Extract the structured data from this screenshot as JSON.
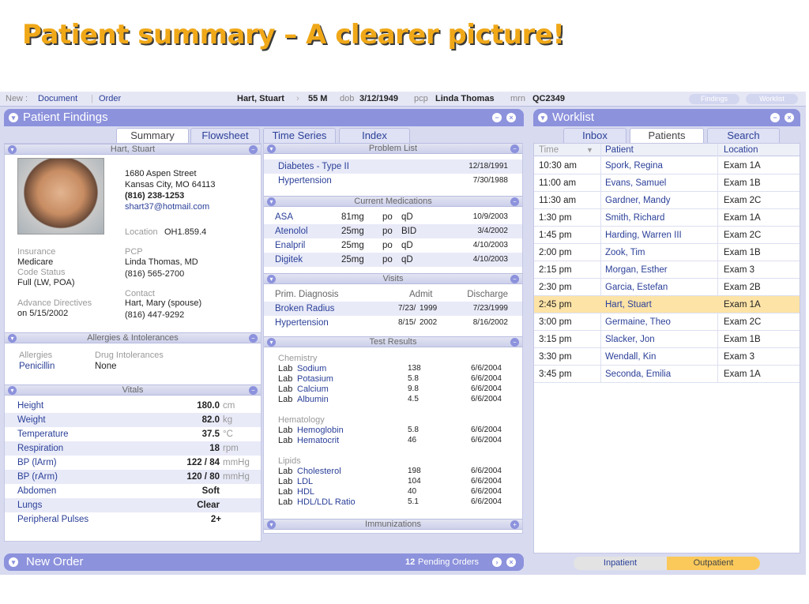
{
  "slide_title": "Patient summary – A clearer picture!",
  "topbar": {
    "new_label": "New :",
    "document": "Document",
    "order": "Order",
    "patient_name": "Hart, Stuart",
    "age_sex": "55 M",
    "dob_label": "dob",
    "dob": "3/12/1949",
    "pcp_label": "pcp",
    "pcp": "Linda Thomas",
    "mrn_label": "mrn",
    "mrn": "QC2349",
    "findings_btn": "Findings",
    "worklist_btn": "Worklist"
  },
  "patient_findings": {
    "title": "Patient Findings",
    "tabs": [
      "Summary",
      "Flowsheet",
      "Time Series",
      "Index"
    ]
  },
  "demographics": {
    "header": "Hart, Stuart",
    "address1": "1680 Aspen Street",
    "address2": "Kansas City, MO 64113",
    "phone": "(816) 238-1253",
    "email": "shart37@hotmail.com",
    "location_label": "Location",
    "location": "OH1.859.4",
    "insurance_label": "Insurance",
    "insurance": "Medicare",
    "code_status_label": "Code Status",
    "code_status": "Full (LW, POA)",
    "pcp_label": "PCP",
    "pcp": "Linda Thomas, MD",
    "pcp_phone": "(816) 565-2700",
    "contact_label": "Contact",
    "contact": "Hart, Mary (spouse)",
    "contact_phone": "(816) 447-9292",
    "advance_label": "Advance Directives",
    "advance": "on 5/15/2002"
  },
  "allergies": {
    "header": "Allergies & Intolerances",
    "col1": "Allergies",
    "col2": "Drug Intolerances",
    "allergy": "Penicillin",
    "intolerance": "None"
  },
  "vitals": {
    "header": "Vitals",
    "rows": [
      {
        "name": "Height",
        "value": "180.0",
        "unit": "cm"
      },
      {
        "name": "Weight",
        "value": "82.0",
        "unit": "kg"
      },
      {
        "name": "Temperature",
        "value": "37.5",
        "unit": "°C"
      },
      {
        "name": "Respiration",
        "value": "18",
        "unit": "rpm"
      },
      {
        "name": "BP (lArm)",
        "value": "122 / 84",
        "unit": "mmHg"
      },
      {
        "name": "BP (rArm)",
        "value": "120 / 80",
        "unit": "mmHg"
      },
      {
        "name": "Abdomen",
        "value": "Soft",
        "unit": ""
      },
      {
        "name": "Lungs",
        "value": "Clear",
        "unit": ""
      },
      {
        "name": "Peripheral Pulses",
        "value": "2+",
        "unit": ""
      }
    ]
  },
  "problem_list": {
    "header": "Problem List",
    "rows": [
      {
        "name": "Diabetes - Type II",
        "date_md": "12/18/",
        "date_y": "1991"
      },
      {
        "name": "Hypertension",
        "date_md": "7/30/",
        "date_y": "1988"
      }
    ]
  },
  "medications": {
    "header": "Current Medications",
    "rows": [
      {
        "drug": "ASA",
        "dose": "81mg",
        "route": "po",
        "freq": "qD",
        "date_md": "10/9/",
        "date_y": "2003"
      },
      {
        "drug": "Atenolol",
        "dose": "25mg",
        "route": "po",
        "freq": "BID",
        "date_md": "3/4/",
        "date_y": "2002"
      },
      {
        "drug": "Enalpril",
        "dose": "25mg",
        "route": "po",
        "freq": "qD",
        "date_md": "4/10/",
        "date_y": "2003"
      },
      {
        "drug": "Digitek",
        "dose": "25mg",
        "route": "po",
        "freq": "qD",
        "date_md": "4/10/",
        "date_y": "2003"
      }
    ]
  },
  "visits": {
    "header": "Visits",
    "col_diag": "Prim. Diagnosis",
    "col_admit": "Admit",
    "col_discharge": "Discharge",
    "rows": [
      {
        "diag": "Broken Radius",
        "admit_md": "7/23/",
        "admit_y": "1999",
        "dis_md": "7/23/",
        "dis_y": "1999"
      },
      {
        "diag": "Hypertension",
        "admit_md": "8/15/",
        "admit_y": "2002",
        "dis_md": "8/16/",
        "dis_y": "2002"
      }
    ]
  },
  "test_results": {
    "header": "Test Results",
    "lab_prefix": "Lab",
    "groups": [
      {
        "name": "Chemistry",
        "rows": [
          {
            "test": "Sodium",
            "value": "138",
            "date": "6/6/2004"
          },
          {
            "test": "Potasium",
            "value": "5.8",
            "date": "6/6/2004"
          },
          {
            "test": "Calcium",
            "value": "9.8",
            "date": "6/6/2004"
          },
          {
            "test": "Albumin",
            "value": "4.5",
            "date": "6/6/2004"
          }
        ]
      },
      {
        "name": "Hematology",
        "rows": [
          {
            "test": "Hemoglobin",
            "value": "5.8",
            "date": "6/6/2004"
          },
          {
            "test": "Hematocrit",
            "value": "46",
            "date": "6/6/2004"
          }
        ]
      },
      {
        "name": "Lipids",
        "rows": [
          {
            "test": "Cholesterol",
            "value": "198",
            "date": "6/6/2004"
          },
          {
            "test": "LDL",
            "value": "104",
            "date": "6/6/2004"
          },
          {
            "test": "HDL",
            "value": "40",
            "date": "6/6/2004"
          },
          {
            "test": "HDL/LDL Ratio",
            "value": "5.1",
            "date": "6/6/2004"
          }
        ]
      }
    ]
  },
  "immunizations": {
    "header": "Immunizations"
  },
  "new_order": {
    "title": "New Order",
    "pending_count": "12",
    "pending_label": "Pending Orders"
  },
  "worklist": {
    "title": "Worklist",
    "tabs": [
      "Inbox",
      "Patients",
      "Search"
    ],
    "columns": [
      "Time",
      "Patient",
      "Location"
    ],
    "rows": [
      {
        "time": "10:30 am",
        "patient": "Spork, Regina",
        "location": "Exam 1A"
      },
      {
        "time": "11:00 am",
        "patient": "Evans, Samuel",
        "location": "Exam 1B"
      },
      {
        "time": "11:30 am",
        "patient": "Gardner, Mandy",
        "location": "Exam 2C"
      },
      {
        "time": "1:30 pm",
        "patient": "Smith, Richard",
        "location": "Exam 1A"
      },
      {
        "time": "1:45 pm",
        "patient": "Harding, Warren III",
        "location": "Exam 2C"
      },
      {
        "time": "2:00 pm",
        "patient": "Zook, Tim",
        "location": "Exam 1B"
      },
      {
        "time": "2:15 pm",
        "patient": "Morgan, Esther",
        "location": "Exam 3"
      },
      {
        "time": "2:30 pm",
        "patient": "Garcia, Estefan",
        "location": "Exam 2B"
      },
      {
        "time": "2:45 pm",
        "patient": "Hart, Stuart",
        "location": "Exam 1A"
      },
      {
        "time": "3:00 pm",
        "patient": "Germaine, Theo",
        "location": "Exam 2C"
      },
      {
        "time": "3:15 pm",
        "patient": "Slacker, Jon",
        "location": "Exam 1B"
      },
      {
        "time": "3:30 pm",
        "patient": "Wendall, Kin",
        "location": "Exam 3"
      },
      {
        "time": "3:45 pm",
        "patient": "Seconda, Emilia",
        "location": "Exam 1A"
      }
    ],
    "selected_index": 8,
    "toggle": [
      "Inpatient",
      "Outpatient"
    ]
  },
  "colors": {
    "accent": "#8c92dc",
    "link": "#2a3f98",
    "title": "#f0a818",
    "selected_row": "#fde3a6"
  }
}
